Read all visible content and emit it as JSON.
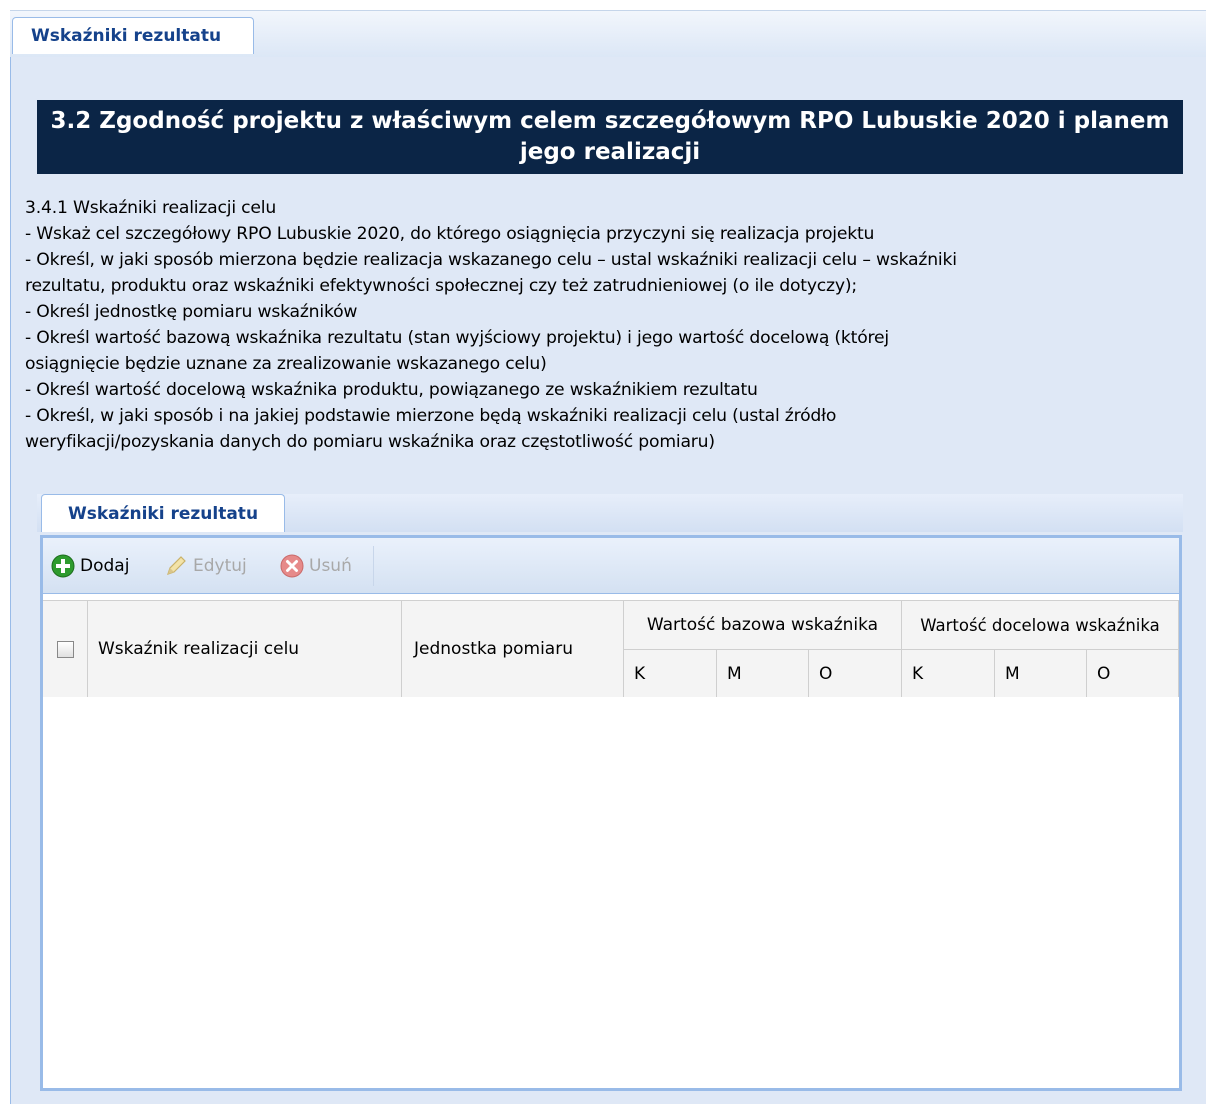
{
  "outer_tab": {
    "label": "Wskaźniki rezultatu"
  },
  "section": {
    "title_line1": "3.2 Zgodność projektu z właściwym celem szczegółowym RPO Lubuskie 2020 i planem",
    "title_line2": "jego realizacji"
  },
  "description": {
    "lines": [
      "3.4.1 Wskaźniki realizacji celu",
      "- Wskaż cel szczegółowy RPO Lubuskie 2020, do którego osiągnięcia przyczyni się realizacja projektu",
      "- Określ, w jaki sposób mierzona będzie realizacja wskazanego celu – ustal wskaźniki realizacji celu – wskaźniki",
      "rezultatu, produktu oraz wskaźniki efektywności społecznej czy też zatrudnieniowej (o ile dotyczy);",
      "- Określ jednostkę pomiaru wskaźników",
      "- Określ wartość bazową wskaźnika rezultatu (stan wyjściowy projektu) i jego wartość docelową (której",
      "osiągnięcie będzie uznane za zrealizowanie wskazanego celu)",
      "- Określ wartość docelową wskaźnika produktu, powiązanego ze wskaźnikiem rezultatu",
      "- Określ, w jaki sposób i na jakiej podstawie mierzone będą wskaźniki realizacji celu (ustal źródło",
      "weryfikacji/pozyskania danych do pomiaru wskaźnika oraz częstotliwość pomiaru)"
    ]
  },
  "inner_tab": {
    "label": "Wskaźniki rezultatu"
  },
  "toolbar": {
    "add_label": "Dodaj",
    "edit_label": "Edytuj",
    "delete_label": "Usuń"
  },
  "grid": {
    "columns": {
      "indicator": "Wskaźnik realizacji celu",
      "unit": "Jednostka pomiaru",
      "base_group": "Wartość bazowa wskaźnika",
      "target_group": "Wartość docelowa wskaźnika",
      "base_k": "K",
      "base_m": "M",
      "base_o": "O",
      "target_k": "K",
      "target_m": "M",
      "target_o": "O"
    },
    "rows": []
  },
  "colors": {
    "header_bg": "#0b2546",
    "tab_text": "#15428b",
    "panel_bg": "#dfe8f6",
    "border": "#99bbe8"
  }
}
